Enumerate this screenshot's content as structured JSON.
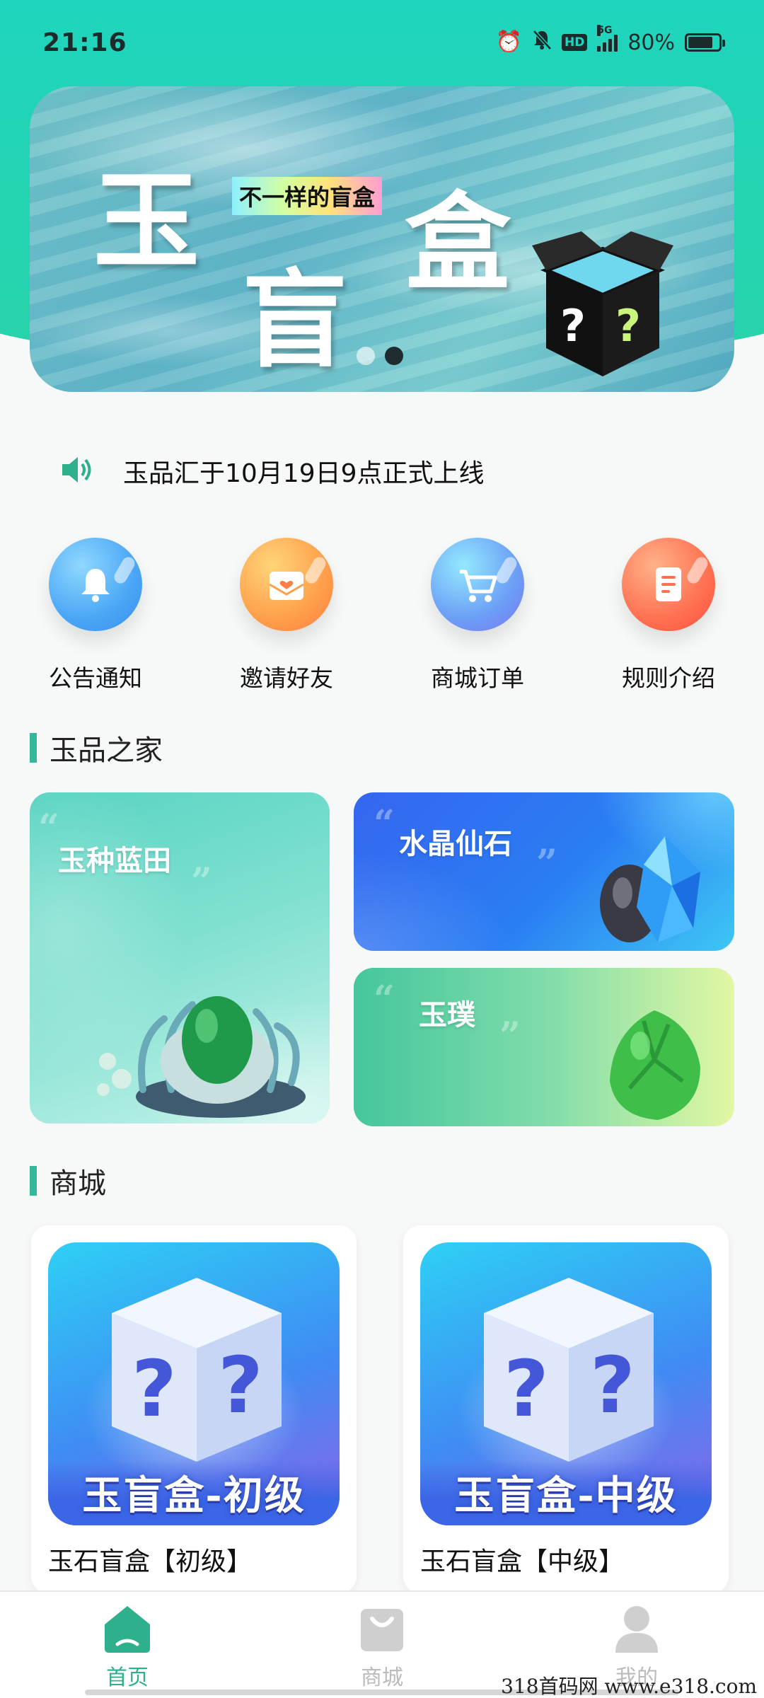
{
  "status_bar": {
    "time": "21:16",
    "network": "5G",
    "hd_label": "HD",
    "battery_text": "80%",
    "battery_level": 0.8
  },
  "banner": {
    "big_chars": [
      "玉",
      "盲",
      "盒"
    ],
    "tag": "不一样的盲盒",
    "box_marks": [
      "?",
      "?"
    ],
    "page_count": 2,
    "active_page": 1
  },
  "notice": {
    "icon": "speaker-icon",
    "text": "玉品汇于10月19日9点正式上线"
  },
  "quick_menu": [
    {
      "label": "公告通知",
      "icon": "bell-icon",
      "color": "#4aa6f5"
    },
    {
      "label": "邀请好友",
      "icon": "invite-envelope-icon",
      "color": "#ff9f4a"
    },
    {
      "label": "商城订单",
      "icon": "cart-icon",
      "color": "#6b9ef6"
    },
    {
      "label": "规则介绍",
      "icon": "document-icon",
      "color": "#ff7151"
    }
  ],
  "sections": {
    "jade_home": "玉品之家",
    "shop": "商城"
  },
  "jade_cards": [
    {
      "title": "玉种蓝田"
    },
    {
      "title": "水晶仙石"
    },
    {
      "title": "玉璞"
    }
  ],
  "shop_items": [
    {
      "ribbon": "玉盲盒-初级",
      "name": "玉石盲盒【初级】"
    },
    {
      "ribbon": "玉盲盒-中级",
      "name": "玉石盲盒【中级】"
    }
  ],
  "bottom_nav": [
    {
      "label": "首页",
      "icon": "home-icon",
      "active": true
    },
    {
      "label": "商城",
      "icon": "shopping-bag-icon",
      "active": false
    },
    {
      "label": "我的",
      "icon": "profile-icon",
      "active": false
    }
  ],
  "watermark": "318首码网 www.e318.com",
  "colors": {
    "brand_green": "#1ed5bf",
    "accent_green": "#37b79a",
    "nav_active": "#2fb08c"
  }
}
